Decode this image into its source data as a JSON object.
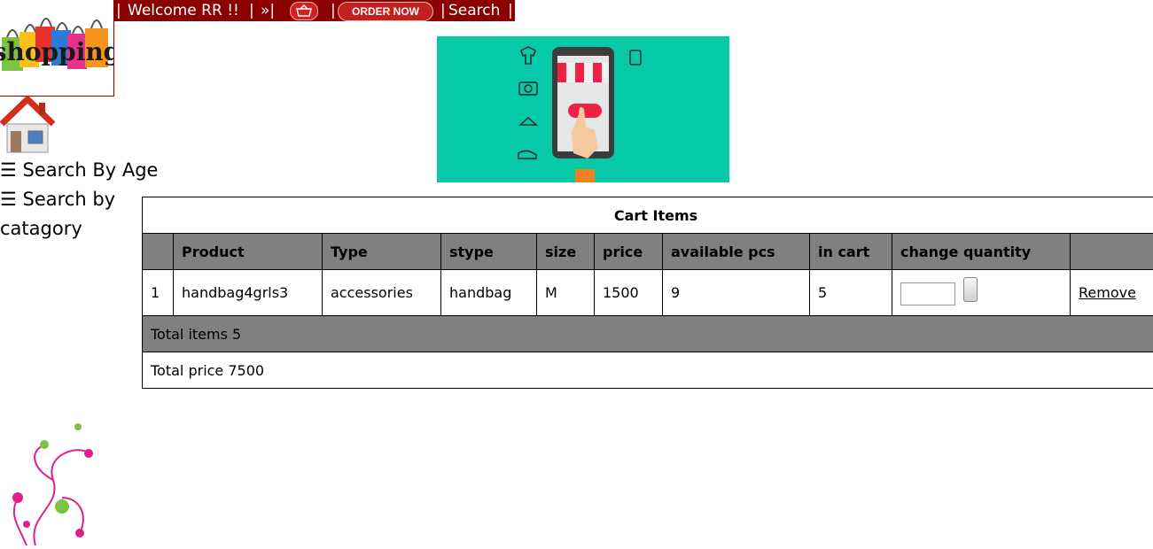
{
  "topbar": {
    "sep1": "|",
    "welcome": "Welcome RR !!",
    "sep2": "|",
    "arrow": "»|",
    "sep3": "|",
    "order_now": "ORDER NOW",
    "sep4": "|",
    "search": "Search",
    "sep5": "|",
    "bar_color": "#8b0000"
  },
  "logo": {
    "text": "shopping",
    "icon": "shopping-bags-logo"
  },
  "sidebar": {
    "home_icon": "house-icon",
    "items": [
      {
        "label": "☰ Search By Age"
      },
      {
        "label": "☰ Search by catagory"
      }
    ]
  },
  "banner": {
    "icon": "mobile-shop-illustration",
    "bg_color": "#05c9a7"
  },
  "cart": {
    "caption": "Cart Items",
    "headers": [
      "",
      "Product",
      "Type",
      "stype",
      "size",
      "price",
      "available pcs",
      "in cart",
      "change quantity",
      ""
    ],
    "rows": [
      {
        "index": "1",
        "product": "handbag4grls3",
        "type": "accessories",
        "stype": "handbag",
        "size": "M",
        "price": "1500",
        "available": "9",
        "in_cart": "5",
        "quantity_value": "",
        "remove_label": "Remove"
      }
    ],
    "total_items": "Total items 5",
    "total_price": "Total price 7500",
    "header_color": "#808080"
  },
  "decoration": {
    "icon": "floral-swirl-decoration"
  }
}
